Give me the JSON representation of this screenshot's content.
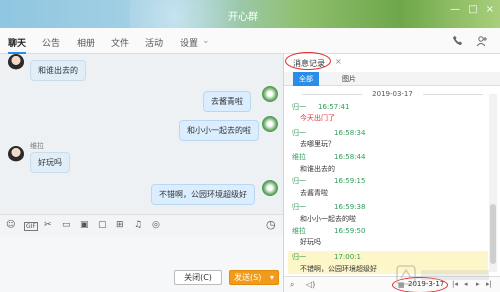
{
  "window": {
    "title": "开心群",
    "controls": [
      "—",
      "□",
      "×"
    ]
  },
  "nav": {
    "tabs": [
      "聊天",
      "公告",
      "相册",
      "文件",
      "活动",
      "设置"
    ],
    "settings_chevron": "⌄",
    "phone_icon": "phone-icon",
    "add_member_icon": "add-member-icon"
  },
  "chat": {
    "messages": [
      {
        "side": "in",
        "text": "和谁出去的"
      },
      {
        "side": "out",
        "text": "去酱青啦"
      },
      {
        "side": "out",
        "text": "和小小一起去的啦"
      },
      {
        "side": "in",
        "sender": "维拉",
        "text": "好玩吗"
      },
      {
        "side": "out",
        "text": "不错啊，公园环境超级好"
      }
    ]
  },
  "toolbar": {
    "icons": [
      "emoji-icon",
      "gif-icon",
      "scissors-icon",
      "folder-icon",
      "image-icon",
      "screen-icon",
      "gift-icon",
      "bell-icon",
      "more-icon"
    ],
    "history_icon": "clock-icon"
  },
  "buttons": {
    "close_label": "关闭(C)",
    "send_label": "发送(S)",
    "send_dropdown": "▾"
  },
  "history": {
    "title": "消息记录",
    "close": "×",
    "tabs": [
      "全部",
      "图片"
    ],
    "date": "2019-03-17",
    "entries": [
      {
        "sender": "归一",
        "time": "16:57:41",
        "text": "今天出门了",
        "red": true
      },
      {
        "sender": "归一",
        "time": "16:58:34",
        "text": "去哪里玩？"
      },
      {
        "sender": "维拉",
        "time": "16:58:44",
        "text": "和谁出去的"
      },
      {
        "sender": "归一",
        "time": "16:59:15",
        "text": "去酱青啦"
      },
      {
        "sender": "归一",
        "time": "16:59:38",
        "text": "和小小一起去的啦"
      },
      {
        "sender": "维拉",
        "time": "16:59:50",
        "text": "好玩吗"
      },
      {
        "sender": "归一",
        "time": "17:00:1",
        "text": "不错啊，公园环境超级好"
      }
    ],
    "footer": {
      "search_icon": "search-icon",
      "audio_icon": "audio-icon",
      "calendar_icon": "calendar-icon",
      "date": "2019-3-17",
      "nav_icons": [
        "first-page-icon",
        "prev-page-icon",
        "next-page-icon",
        "last-page-icon"
      ]
    }
  }
}
